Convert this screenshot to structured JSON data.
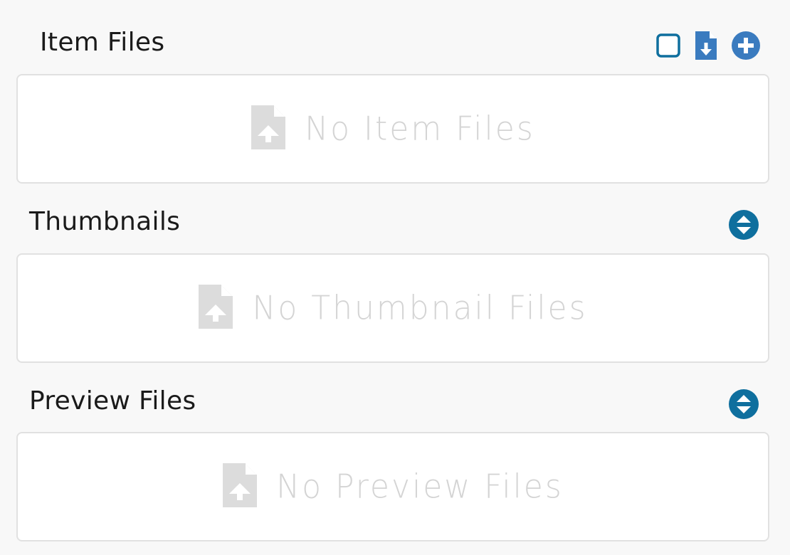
{
  "sections": [
    {
      "title": "Item Files",
      "empty_text": "No Item Files",
      "actions": [
        "select-all-checkbox",
        "download-file-icon",
        "add-circle-icon"
      ]
    },
    {
      "title": "Thumbnails",
      "empty_text": "No Thumbnail Files",
      "actions": [
        "expand-collapse-icon"
      ]
    },
    {
      "title": "Preview Files",
      "empty_text": "No Preview Files",
      "actions": [
        "expand-collapse-icon"
      ]
    }
  ],
  "colors": {
    "background": "#f8f8f8",
    "accent_blue": "#3a7bbf",
    "accent_teal": "#0f6f9e",
    "empty_gray": "#d6d6d6",
    "border": "#e1e1e1"
  }
}
